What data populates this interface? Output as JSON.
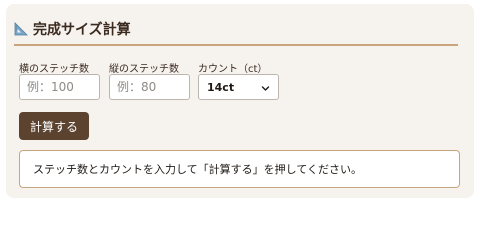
{
  "header": {
    "icon": "triangular-ruler-icon",
    "title": "完成サイズ計算"
  },
  "form": {
    "width_stitches": {
      "label": "横のステッチ数",
      "placeholder": "例：100",
      "value": ""
    },
    "height_stitches": {
      "label": "縦のステッチ数",
      "placeholder": "例：80",
      "value": ""
    },
    "count": {
      "label": "カウント（ct）",
      "selected": "14ct"
    }
  },
  "actions": {
    "calculate_label": "計算する"
  },
  "result": {
    "message": "ステッチ数とカウントを入力して「計算する」を押してください。"
  },
  "colors": {
    "panel_bg": "#f6f2ee",
    "accent_line": "#caa57c",
    "button_bg": "#5b4330",
    "text": "#3a2a1f"
  }
}
